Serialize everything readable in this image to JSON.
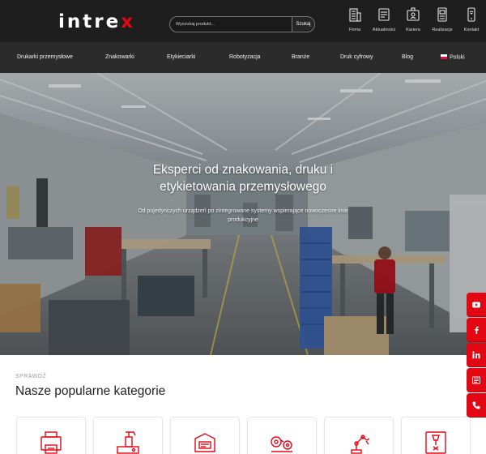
{
  "header": {
    "logo_text": "intrex",
    "search_placeholder": "Wyszukaj produkt...",
    "search_button": "Szukaj",
    "top_links": [
      {
        "label": "Firma",
        "icon": "building-icon"
      },
      {
        "label": "Aktualności",
        "icon": "news-icon"
      },
      {
        "label": "Kariera",
        "icon": "career-icon"
      },
      {
        "label": "Realizacje",
        "icon": "projects-icon"
      },
      {
        "label": "Kontakt",
        "icon": "phone-icon"
      }
    ]
  },
  "nav": {
    "items": [
      "Drukarki przemysłowe",
      "Znakowarki",
      "Etykieciarki",
      "Robotyzacja",
      "Branże",
      "Druk cyfrowy",
      "Blog"
    ],
    "language": "Polski"
  },
  "hero": {
    "title": "Eksperci od znakowania, druku i etykietowania przemysłowego",
    "subtitle": "Od pojedynczych urządzeń po zintegrowane systemy wspierające nowoczesne linie produkcyjne"
  },
  "social": [
    "youtube-icon",
    "facebook-icon",
    "linkedin-icon",
    "newsletter-icon",
    "phone-icon"
  ],
  "categories": {
    "kicker": "SPRAWDŹ",
    "title": "Nasze popularne kategorie",
    "cards": [
      "printer-category-icon",
      "label-applicator-icon",
      "marking-machine-icon",
      "unwinder-icon",
      "robot-arm-icon",
      "laser-icon"
    ]
  },
  "colors": {
    "accent": "#e30613",
    "header_bg": "#1e1e1e",
    "nav_bg": "#2b2b2b"
  }
}
